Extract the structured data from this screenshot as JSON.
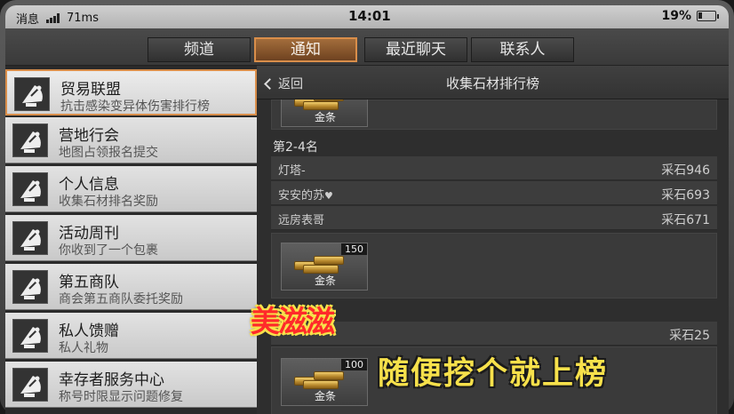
{
  "status_bar": {
    "messages_label": "消息",
    "ping": "71ms",
    "time": "14:01",
    "battery": "19%"
  },
  "tabs": [
    {
      "label": "频道",
      "active": false
    },
    {
      "label": "通知",
      "active": true
    },
    {
      "label": "最近聊天",
      "active": false
    },
    {
      "label": "联系人",
      "active": false
    }
  ],
  "notifications": [
    {
      "title": "贸易联盟",
      "subtitle": "抗击感染变异体伤害排行榜",
      "active": true,
      "icon": "satellite-dish-icon"
    },
    {
      "title": "营地行会",
      "subtitle": "地图占领报名提交",
      "active": false,
      "icon": "satellite-dish-icon"
    },
    {
      "title": "个人信息",
      "subtitle": "收集石材排名奖励",
      "active": false,
      "icon": "satellite-dish-icon"
    },
    {
      "title": "活动周刊",
      "subtitle": "你收到了一个包裹",
      "active": false,
      "icon": "satellite-dish-icon"
    },
    {
      "title": "第五商队",
      "subtitle": "商会第五商队委托奖励",
      "active": false,
      "icon": "satellite-dish-icon"
    },
    {
      "title": "私人馈赠",
      "subtitle": "私人礼物",
      "active": false,
      "icon": "satellite-dish-icon"
    },
    {
      "title": "幸存者服务中心",
      "subtitle": "称号时限显示问题修复",
      "active": false,
      "icon": "satellite-dish-icon"
    }
  ],
  "panel": {
    "back_label": "返回",
    "title": "收集石材排行榜",
    "rewards": [
      {
        "item": "金条",
        "count": ""
      },
      {
        "item": "金条",
        "count": "150"
      },
      {
        "item": "金条",
        "count": "100"
      }
    ],
    "section_label": "第2-4名",
    "ranks": [
      {
        "name": "灯塔-",
        "score": "采石946",
        "heart": false
      },
      {
        "name": "安安的苏",
        "score": "采石693",
        "heart": true
      },
      {
        "name": "远房表哥",
        "score": "采石671",
        "heart": false
      }
    ],
    "extra_score": "采石25"
  },
  "overlay": {
    "brand": "美滋滋",
    "slogan": "随便挖个就上榜"
  },
  "colors": {
    "accent": "#d98e4a",
    "overlay_red": "#ff2a2a",
    "overlay_yellow": "#f7e14b"
  }
}
